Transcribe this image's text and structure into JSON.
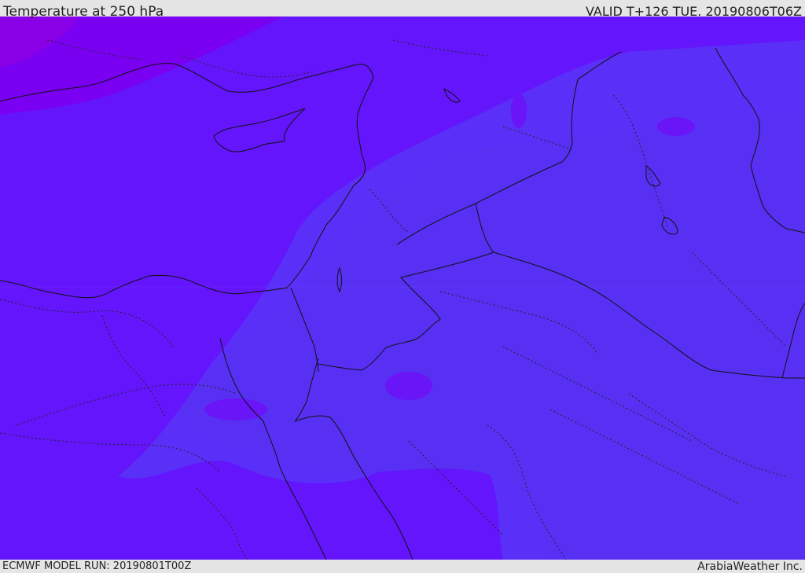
{
  "header": {
    "title": "Temperature at 250 hPa",
    "valid_time": "VALID T+126 TUE. 20190806T06Z"
  },
  "footer": {
    "model_run": "ECMWF MODEL RUN: 20190801T00Z",
    "credit": "ArabiaWeather Inc."
  },
  "map": {
    "variable": "temperature",
    "level": "250 hPa",
    "fill_colors": {
      "coldest": "#8a00ee",
      "cold": "#7300f5",
      "base": "#6415fb",
      "warm": "#5a2ef6",
      "warmest": "#5530f2"
    },
    "border_color": "#111111"
  }
}
